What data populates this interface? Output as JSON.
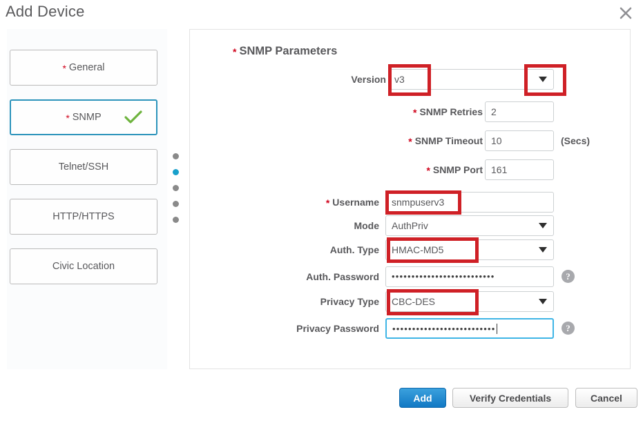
{
  "dialog": {
    "title": "Add Device",
    "close_icon": "close-icon"
  },
  "sidebar": {
    "items": [
      {
        "label": "General",
        "required": true,
        "active": false,
        "complete": false
      },
      {
        "label": "SNMP",
        "required": true,
        "active": true,
        "complete": true
      },
      {
        "label": "Telnet/SSH",
        "required": false,
        "active": false,
        "complete": false
      },
      {
        "label": "HTTP/HTTPS",
        "required": false,
        "active": false,
        "complete": false
      },
      {
        "label": "Civic Location",
        "required": false,
        "active": false,
        "complete": false
      }
    ],
    "step_dots": {
      "count": 5,
      "active_index": 1
    }
  },
  "main": {
    "section_title": "SNMP Parameters",
    "section_required": true,
    "fields": {
      "version": {
        "label": "Version",
        "value": "v3",
        "type": "select",
        "required": false
      },
      "snmp_retries": {
        "label": "SNMP Retries",
        "value": "2",
        "type": "text",
        "required": true
      },
      "snmp_timeout": {
        "label": "SNMP Timeout",
        "value": "10",
        "type": "text",
        "required": true,
        "suffix": "(Secs)"
      },
      "snmp_port": {
        "label": "SNMP Port",
        "value": "161",
        "type": "text",
        "required": true
      },
      "username": {
        "label": "Username",
        "value": "snmpuserv3",
        "type": "text",
        "required": true
      },
      "mode": {
        "label": "Mode",
        "value": "AuthPriv",
        "type": "select",
        "required": false
      },
      "auth_type": {
        "label": "Auth. Type",
        "value": "HMAC-MD5",
        "type": "select",
        "required": false
      },
      "auth_password": {
        "label": "Auth. Password",
        "value": "••••••••••••••••••••••••••",
        "type": "password",
        "required": false,
        "help": true
      },
      "privacy_type": {
        "label": "Privacy Type",
        "value": "CBC-DES",
        "type": "select",
        "required": false
      },
      "privacy_password": {
        "label": "Privacy Password",
        "value": "••••••••••••••••••••••••••",
        "type": "password",
        "required": false,
        "help": true,
        "focused": true
      }
    },
    "help_icon_glyph": "?"
  },
  "footer": {
    "add_label": "Add",
    "verify_label": "Verify Credentials",
    "cancel_label": "Cancel"
  },
  "colors": {
    "annotation_red": "#cf2026",
    "active_tab_blue": "#2b93bb",
    "check_green": "#6eb33e",
    "primary_button_blue": "#1178c4",
    "required_star_red": "#d0021b",
    "focus_blue": "#3eb5e6"
  }
}
